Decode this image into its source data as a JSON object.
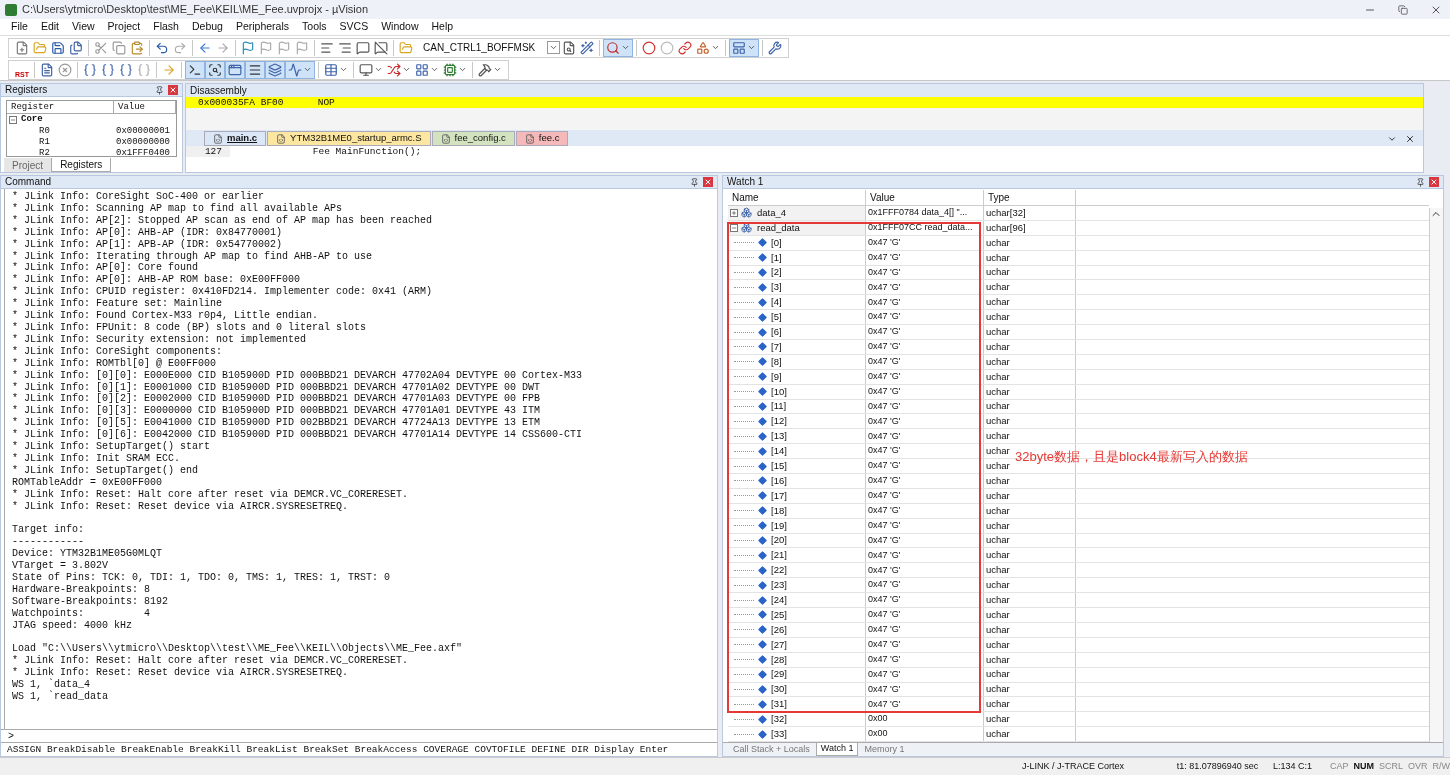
{
  "window": {
    "title": "C:\\Users\\ytmicro\\Desktop\\test\\ME_Fee\\KEIL\\ME_Fee.uvprojx - µVision"
  },
  "menu": [
    "File",
    "Edit",
    "View",
    "Project",
    "Flash",
    "Debug",
    "Peripherals",
    "Tools",
    "SVCS",
    "Window",
    "Help"
  ],
  "toolbar": {
    "find_combo": "CAN_CTRL1_BOFFMSK",
    "reset_label": "RST"
  },
  "registers": {
    "title": "Registers",
    "columns": [
      "Register",
      "Value"
    ],
    "tree": [
      {
        "name": "Core",
        "expanded": true,
        "children": [
          {
            "name": "R0",
            "value": "0x00000001"
          },
          {
            "name": "R1",
            "value": "0x00000000"
          },
          {
            "name": "R2",
            "value": "0x1FFF0400"
          }
        ]
      }
    ],
    "tabs": [
      {
        "label": "Project",
        "selected": false
      },
      {
        "label": "Registers",
        "selected": true
      }
    ]
  },
  "disassembly": {
    "title": "Disassembly",
    "current_line": "0x000035FA BF00      NOP"
  },
  "editor": {
    "tabs": [
      {
        "label": "main.c",
        "selected": true,
        "color": "#dbe6f7"
      },
      {
        "label": "YTM32B1ME0_startup_armc.S",
        "selected": false,
        "color": "#fde7a0"
      },
      {
        "label": "fee_config.c",
        "selected": false,
        "color": "#d3e3c0"
      },
      {
        "label": "fee.c",
        "selected": false,
        "color": "#f5b9b9"
      }
    ],
    "lines": [
      {
        "number": "127",
        "code": "    Fee MainFunction();"
      }
    ]
  },
  "command": {
    "title": "Command",
    "blocks": [
      [
        "* JLink Info: CoreSight SoC-400 or earlier",
        "* JLink Info: Scanning AP map to find all available APs",
        "* JLink Info: AP[2]: Stopped AP scan as end of AP map has been reached",
        "* JLink Info: AP[0]: AHB-AP (IDR: 0x84770001)",
        "* JLink Info: AP[1]: APB-AP (IDR: 0x54770002)",
        "* JLink Info: Iterating through AP map to find AHB-AP to use",
        "* JLink Info: AP[0]: Core found",
        "* JLink Info: AP[0]: AHB-AP ROM base: 0xE00FF000",
        "* JLink Info: CPUID register: 0x410FD214. Implementer code: 0x41 (ARM)",
        "* JLink Info: Feature set: Mainline",
        "* JLink Info: Found Cortex-M33 r0p4, Little endian.",
        "* JLink Info: FPUnit: 8 code (BP) slots and 0 literal slots",
        "* JLink Info: Security extension: not implemented",
        "* JLink Info: CoreSight components:",
        "* JLink Info: ROMTbl[0] @ E00FF000",
        "* JLink Info: [0][0]: E000E000 CID B105900D PID 000BBD21 DEVARCH 47702A04 DEVTYPE 00 Cortex-M33",
        "* JLink Info: [0][1]: E0001000 CID B105900D PID 000BBD21 DEVARCH 47701A02 DEVTYPE 00 DWT",
        "* JLink Info: [0][2]: E0002000 CID B105900D PID 000BBD21 DEVARCH 47701A03 DEVTYPE 00 FPB",
        "* JLink Info: [0][3]: E0000000 CID B105900D PID 000BBD21 DEVARCH 47701A01 DEVTYPE 43 ITM",
        "* JLink Info: [0][5]: E0041000 CID B105900D PID 002BBD21 DEVARCH 47724A13 DEVTYPE 13 ETM",
        "* JLink Info: [0][6]: E0042000 CID B105900D PID 000BBD21 DEVARCH 47701A14 DEVTYPE 14 CSS600-CTI",
        "* JLink Info: SetupTarget() start",
        "* JLink Info: Init SRAM ECC.",
        "* JLink Info: SetupTarget() end",
        "ROMTableAddr = 0xE00FF000",
        "* JLink Info: Reset: Halt core after reset via DEMCR.VC_CORERESET.",
        "* JLink Info: Reset: Reset device via AIRCR.SYSRESETREQ."
      ],
      [
        "Target info:",
        "------------",
        "Device: YTM32B1ME05G0MLQT",
        "VTarget = 3.802V",
        "State of Pins: TCK: 0, TDI: 1, TDO: 0, TMS: 1, TRES: 1, TRST: 0",
        "Hardware-Breakpoints: 8",
        "Software-Breakpoints: 8192",
        "Watchpoints:          4",
        "JTAG speed: 4000 kHz"
      ],
      [
        "Load \"C:\\\\Users\\\\ytmicro\\\\Desktop\\\\test\\\\ME_Fee\\\\KEIL\\\\Objects\\\\ME_Fee.axf\"",
        "* JLink Info: Reset: Halt core after reset via DEMCR.VC_CORERESET.",
        "* JLink Info: Reset: Reset device via AIRCR.SYSRESETREQ.",
        "WS 1, `data_4",
        "WS 1, `read_data"
      ]
    ],
    "prompt": ">",
    "hint": "ASSIGN BreakDisable BreakEnable BreakKill BreakList BreakSet BreakAccess COVERAGE COVTOFILE DEFINE DIR Display Enter"
  },
  "watch": {
    "title": "Watch 1",
    "columns": [
      "Name",
      "Value",
      "Type"
    ],
    "rows": [
      {
        "name": "data_4",
        "value": "0x1FFF0784 data_4[] \"...",
        "type": "uchar[32]",
        "expanded": false
      },
      {
        "name": "read_data",
        "value": "0x1FFF07CC read_data...",
        "type": "uchar[96]",
        "expanded": true,
        "children": [
          {
            "name": "[0]",
            "value": "0x47 'G'",
            "type": "uchar"
          },
          {
            "name": "[1]",
            "value": "0x47 'G'",
            "type": "uchar"
          },
          {
            "name": "[2]",
            "value": "0x47 'G'",
            "type": "uchar"
          },
          {
            "name": "[3]",
            "value": "0x47 'G'",
            "type": "uchar"
          },
          {
            "name": "[4]",
            "value": "0x47 'G'",
            "type": "uchar"
          },
          {
            "name": "[5]",
            "value": "0x47 'G'",
            "type": "uchar"
          },
          {
            "name": "[6]",
            "value": "0x47 'G'",
            "type": "uchar"
          },
          {
            "name": "[7]",
            "value": "0x47 'G'",
            "type": "uchar"
          },
          {
            "name": "[8]",
            "value": "0x47 'G'",
            "type": "uchar"
          },
          {
            "name": "[9]",
            "value": "0x47 'G'",
            "type": "uchar"
          },
          {
            "name": "[10]",
            "value": "0x47 'G'",
            "type": "uchar"
          },
          {
            "name": "[11]",
            "value": "0x47 'G'",
            "type": "uchar"
          },
          {
            "name": "[12]",
            "value": "0x47 'G'",
            "type": "uchar"
          },
          {
            "name": "[13]",
            "value": "0x47 'G'",
            "type": "uchar"
          },
          {
            "name": "[14]",
            "value": "0x47 'G'",
            "type": "uchar"
          },
          {
            "name": "[15]",
            "value": "0x47 'G'",
            "type": "uchar"
          },
          {
            "name": "[16]",
            "value": "0x47 'G'",
            "type": "uchar"
          },
          {
            "name": "[17]",
            "value": "0x47 'G'",
            "type": "uchar"
          },
          {
            "name": "[18]",
            "value": "0x47 'G'",
            "type": "uchar"
          },
          {
            "name": "[19]",
            "value": "0x47 'G'",
            "type": "uchar"
          },
          {
            "name": "[20]",
            "value": "0x47 'G'",
            "type": "uchar"
          },
          {
            "name": "[21]",
            "value": "0x47 'G'",
            "type": "uchar"
          },
          {
            "name": "[22]",
            "value": "0x47 'G'",
            "type": "uchar"
          },
          {
            "name": "[23]",
            "value": "0x47 'G'",
            "type": "uchar"
          },
          {
            "name": "[24]",
            "value": "0x47 'G'",
            "type": "uchar"
          },
          {
            "name": "[25]",
            "value": "0x47 'G'",
            "type": "uchar"
          },
          {
            "name": "[26]",
            "value": "0x47 'G'",
            "type": "uchar"
          },
          {
            "name": "[27]",
            "value": "0x47 'G'",
            "type": "uchar"
          },
          {
            "name": "[28]",
            "value": "0x47 'G'",
            "type": "uchar"
          },
          {
            "name": "[29]",
            "value": "0x47 'G'",
            "type": "uchar"
          },
          {
            "name": "[30]",
            "value": "0x47 'G'",
            "type": "uchar"
          },
          {
            "name": "[31]",
            "value": "0x47 'G'",
            "type": "uchar"
          },
          {
            "name": "[32]",
            "value": "0x00",
            "type": "uchar"
          },
          {
            "name": "[33]",
            "value": "0x00",
            "type": "uchar"
          }
        ]
      }
    ],
    "annotation": "32byte数据，且是block4最新写入的数据",
    "tabs": [
      {
        "label": "Call Stack + Locals",
        "selected": false
      },
      {
        "label": "Watch 1",
        "selected": true
      },
      {
        "label": "Memory 1",
        "selected": false
      }
    ]
  },
  "status_bar": {
    "target": "J-LINK / J-TRACE Cortex",
    "time": "t1: 81.07896940 sec",
    "position": "L:134 C:1",
    "indicators": [
      {
        "label": "CAP",
        "on": false
      },
      {
        "label": "NUM",
        "on": true
      },
      {
        "label": "SCRL",
        "on": false
      },
      {
        "label": "OVR",
        "on": false
      },
      {
        "label": "R/W",
        "on": false
      }
    ]
  }
}
